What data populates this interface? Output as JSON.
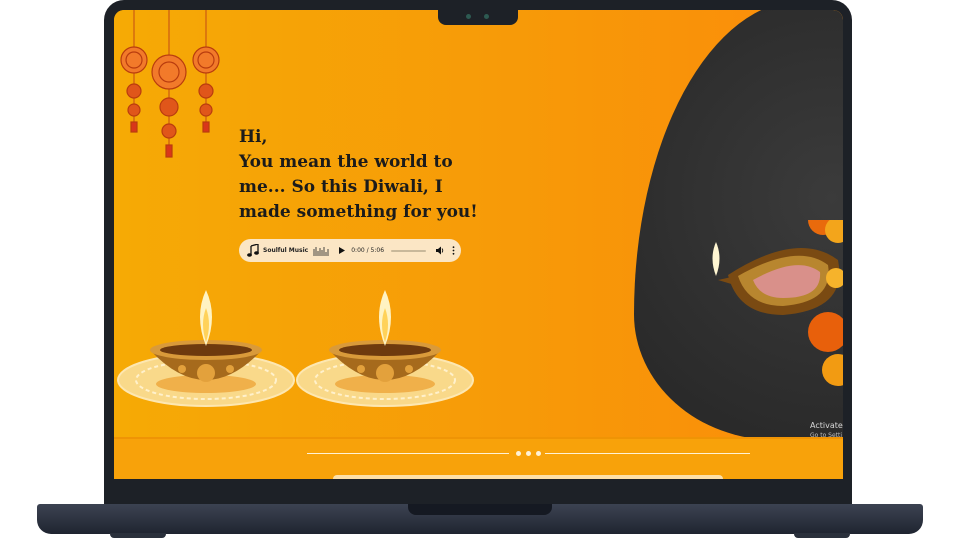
{
  "greeting": {
    "text": "Hi,\nYou mean the world to me... So this Diwali, I made something for you!"
  },
  "player": {
    "track_name": "Soulful Music",
    "time": "0:00 / 5:06",
    "progress": 0,
    "icons": {
      "note": "music-note-icon",
      "bars": "equalizer-icon",
      "play": "play-icon",
      "volume": "volume-icon",
      "more": "more-vertical-icon"
    }
  },
  "watermark": {
    "title": "Activate",
    "subtitle": "Go to Setti"
  },
  "colors": {
    "background": "#f79a08",
    "dark_panel": "#2e2e2e",
    "player_bg": "#fbe6c5",
    "text": "#1b1b1b"
  }
}
